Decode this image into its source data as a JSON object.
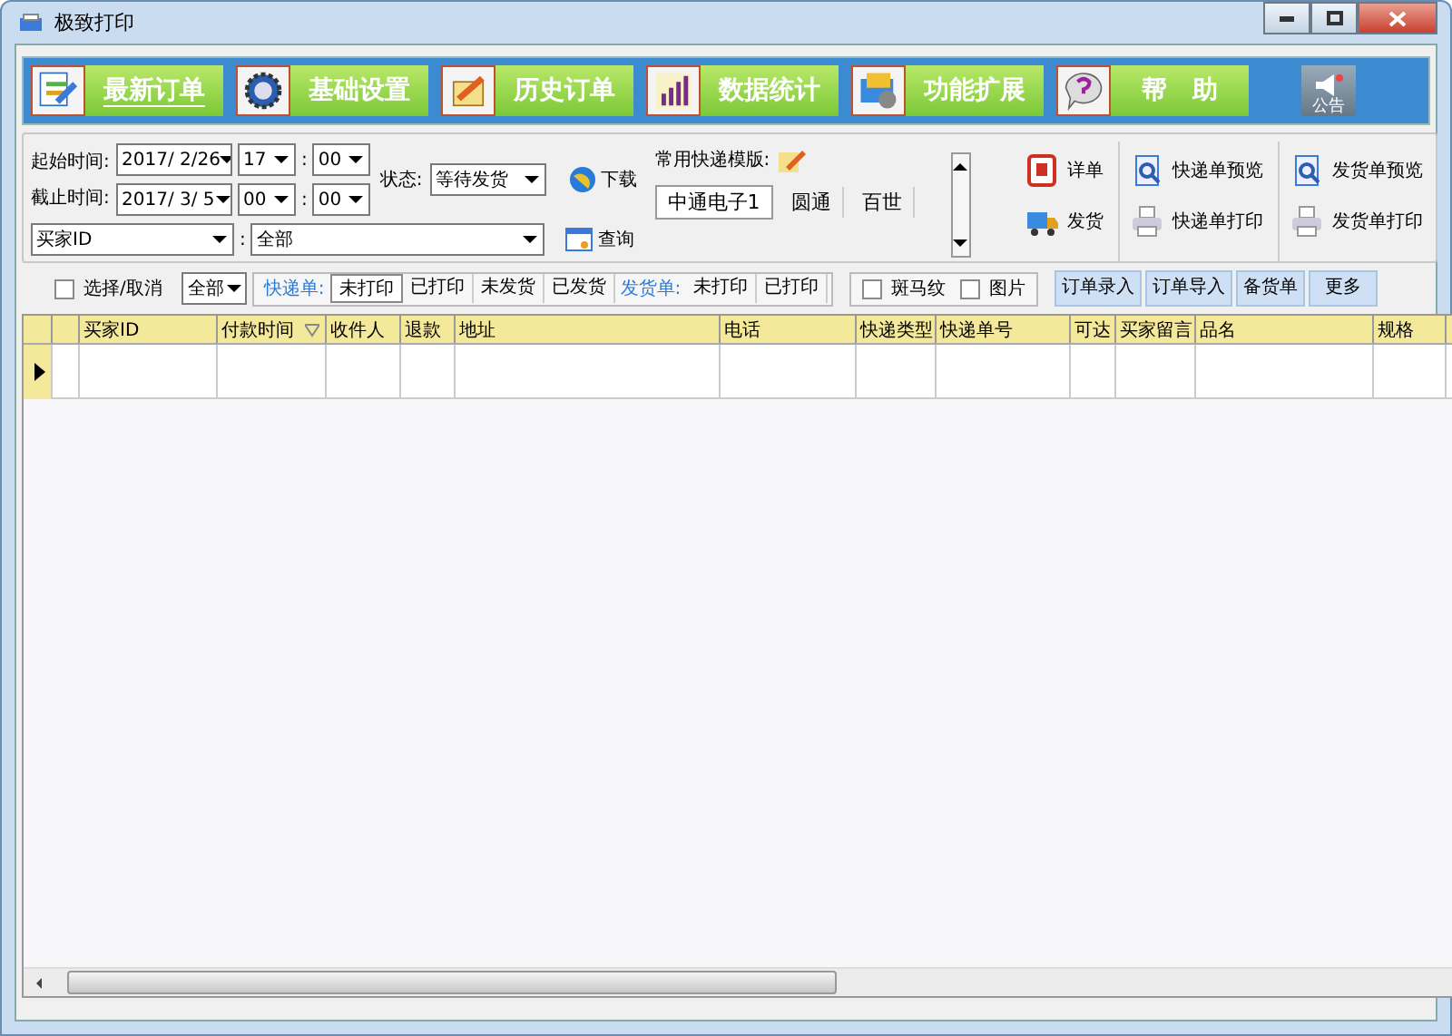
{
  "window": {
    "title": "极致打印"
  },
  "nav": {
    "items": [
      {
        "label": "最新订单",
        "selected": true
      },
      {
        "label": "基础设置",
        "selected": false
      },
      {
        "label": "历史订单",
        "selected": false
      },
      {
        "label": "数据统计",
        "selected": false
      },
      {
        "label": "功能扩展",
        "selected": false
      },
      {
        "label": "帮　助",
        "selected": false
      }
    ],
    "notice": "公告"
  },
  "filters": {
    "start_label": "起始时间:",
    "start_date": "2017/ 2/26",
    "start_hour": "17",
    "start_separator": ":",
    "start_minute": "00",
    "end_label": "截止时间:",
    "end_date": "2017/ 3/ 5",
    "end_hour": "00",
    "end_separator": ":",
    "end_minute": "00",
    "status_label": "状态:",
    "status_value": "等待发货",
    "download": "下载",
    "field": "买家ID",
    "colon": ":",
    "field_value": "全部",
    "query": "查询"
  },
  "templates": {
    "label": "常用快递模版:",
    "items": [
      {
        "label": "中通电子1",
        "selected": true
      },
      {
        "label": "圆通",
        "selected": false
      },
      {
        "label": "百世",
        "selected": false
      }
    ]
  },
  "actions": [
    {
      "label": "详单",
      "kind": "detail"
    },
    {
      "label": "发货",
      "kind": "ship"
    },
    {
      "label": "快递单预览",
      "kind": "preview"
    },
    {
      "label": "快递单打印",
      "kind": "print"
    },
    {
      "label": "发货单预览",
      "kind": "preview"
    },
    {
      "label": "发货单打印",
      "kind": "print"
    }
  ],
  "toolbar": {
    "select_all": {
      "label": "选择/取消",
      "checked": false
    },
    "scope": "全部",
    "express_label": "快递单:",
    "express_tabs": [
      {
        "label": "未打印",
        "selected": true
      },
      {
        "label": "已打印",
        "selected": false
      },
      {
        "label": "未发货",
        "selected": false
      },
      {
        "label": "已发货",
        "selected": false
      }
    ],
    "invoice_label": "发货单:",
    "invoice_tabs": [
      {
        "label": "未打印",
        "selected": false
      },
      {
        "label": "已打印",
        "selected": false
      }
    ],
    "options": [
      {
        "label": "斑马纹",
        "checked": false
      },
      {
        "label": "图片",
        "checked": false
      }
    ],
    "buttons": [
      "订单录入",
      "订单导入",
      "备货单",
      "更多"
    ]
  },
  "table": {
    "columns": [
      {
        "label": "买家ID",
        "sorted": false
      },
      {
        "label": "付款时间",
        "sorted": true
      },
      {
        "label": "收件人",
        "sorted": false
      },
      {
        "label": "退款",
        "sorted": false
      },
      {
        "label": "地址",
        "sorted": false
      },
      {
        "label": "电话",
        "sorted": false
      },
      {
        "label": "快递类型",
        "sorted": false
      },
      {
        "label": "快递单号",
        "sorted": false
      },
      {
        "label": "可达",
        "sorted": false
      },
      {
        "label": "买家留言",
        "sorted": false
      },
      {
        "label": "品名",
        "sorted": false
      },
      {
        "label": "规格",
        "sorted": false
      }
    ]
  }
}
